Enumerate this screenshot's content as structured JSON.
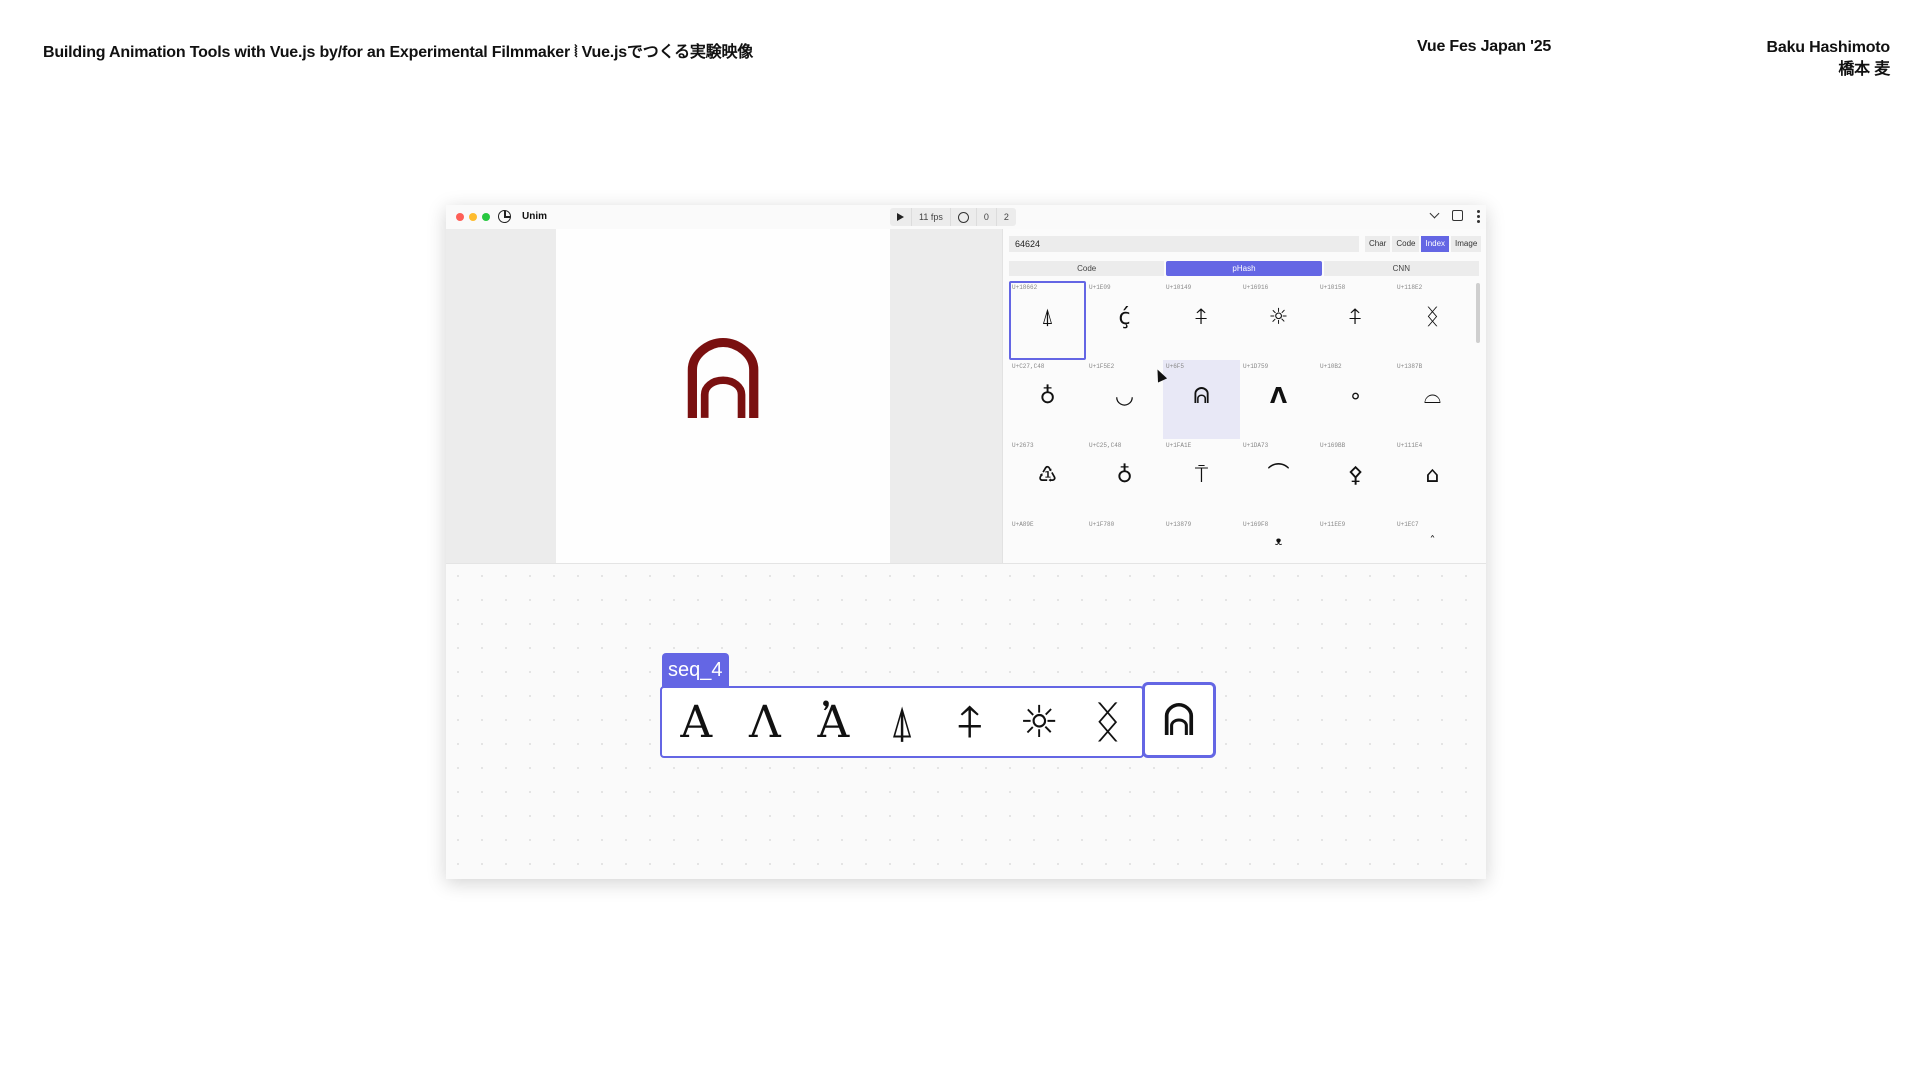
{
  "slide": {
    "title": "Building Animation Tools with Vue.js by/for an Experimental Filmmaker ⦚ Vue.jsでつくる実験映像",
    "event": "Vue Fes Japan '25",
    "author_en": "Baku Hashimoto",
    "author_ja": "橋本 麦"
  },
  "app": {
    "name": "Unim",
    "transport": {
      "fps": "11 fps",
      "onion_before": "0",
      "onion_after": "2"
    },
    "icons": [
      "play-icon",
      "onion-skin-icon",
      "chevron-down-icon",
      "fullscreen-icon",
      "more-icon"
    ]
  },
  "viewport": {
    "glyph": "ᕱ",
    "glyph_color": "#7a1010"
  },
  "panel": {
    "search_value": "64624",
    "modes": [
      {
        "label": "Char",
        "active": false
      },
      {
        "label": "Code",
        "active": false
      },
      {
        "label": "Index",
        "active": true
      },
      {
        "label": "Image",
        "active": false
      }
    ],
    "subtabs": [
      {
        "label": "Code",
        "active": false
      },
      {
        "label": "pHash",
        "active": true
      },
      {
        "label": "CNN",
        "active": false
      }
    ],
    "cells": [
      {
        "code": "U+18662",
        "glyph": "⍋",
        "selected": true
      },
      {
        "code": "U+1E09",
        "glyph": "ḉ"
      },
      {
        "code": "U+10149",
        "glyph": "⍏"
      },
      {
        "code": "U+16916",
        "glyph": "☼"
      },
      {
        "code": "U+10158",
        "glyph": "⍏"
      },
      {
        "code": "U+118E2",
        "glyph": "ᛝ"
      },
      {
        "code": "U+C27,C48",
        "glyph": "♁"
      },
      {
        "code": "U+1F5E2",
        "glyph": "◡"
      },
      {
        "code": "U+6F5",
        "glyph": "ᕱ",
        "hover": true
      },
      {
        "code": "U+1D759",
        "glyph": "𝝠"
      },
      {
        "code": "U+10B2",
        "glyph": "∘"
      },
      {
        "code": "U+1387B",
        "glyph": "⌓"
      },
      {
        "code": "U+2673",
        "glyph": "♳"
      },
      {
        "code": "U+C25,C48",
        "glyph": "♁"
      },
      {
        "code": "U+1FA1E",
        "glyph": "⍑"
      },
      {
        "code": "U+1DA73",
        "glyph": "⌒"
      },
      {
        "code": "U+169BB",
        "glyph": "⚴"
      },
      {
        "code": "U+111E4",
        "glyph": "⌂"
      },
      {
        "code": "U+A89E",
        "glyph": ""
      },
      {
        "code": "U+1F780",
        "glyph": ""
      },
      {
        "code": "U+13879",
        "glyph": ""
      },
      {
        "code": "U+169F8",
        "glyph": "ᴥ"
      },
      {
        "code": "U+11EE9",
        "glyph": ""
      },
      {
        "code": "U+1EC7",
        "glyph": "ˆ"
      }
    ]
  },
  "timeline": {
    "sequence_name": "seq_4",
    "frames": [
      "A",
      "Λ",
      "Ἀ",
      "⍋",
      "⍏",
      "☼",
      "ᛝ"
    ],
    "current_frame": "ᕱ",
    "accent": "#6466e4"
  }
}
